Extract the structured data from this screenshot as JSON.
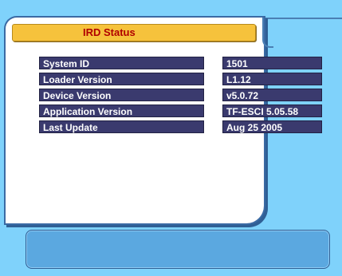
{
  "header": {
    "title": "IRD Status"
  },
  "status": {
    "rows": [
      {
        "label": "System ID",
        "value": "1501"
      },
      {
        "label": "Loader Version",
        "value": "L1.12"
      },
      {
        "label": "Device Version",
        "value": "v5.0.72"
      },
      {
        "label": "Application Version",
        "value": "TF-ESCI 5.05.58"
      },
      {
        "label": "Last Update",
        "value": "Aug 25 2005"
      }
    ]
  },
  "colors": {
    "background": "#7fd2fb",
    "panel": "#ffffff",
    "title_bar": "#f6c23c",
    "title_text": "#b00000",
    "row_bg": "#3a3a6e",
    "message_box": "#5ba8e0"
  },
  "message_box": {
    "text": ""
  }
}
